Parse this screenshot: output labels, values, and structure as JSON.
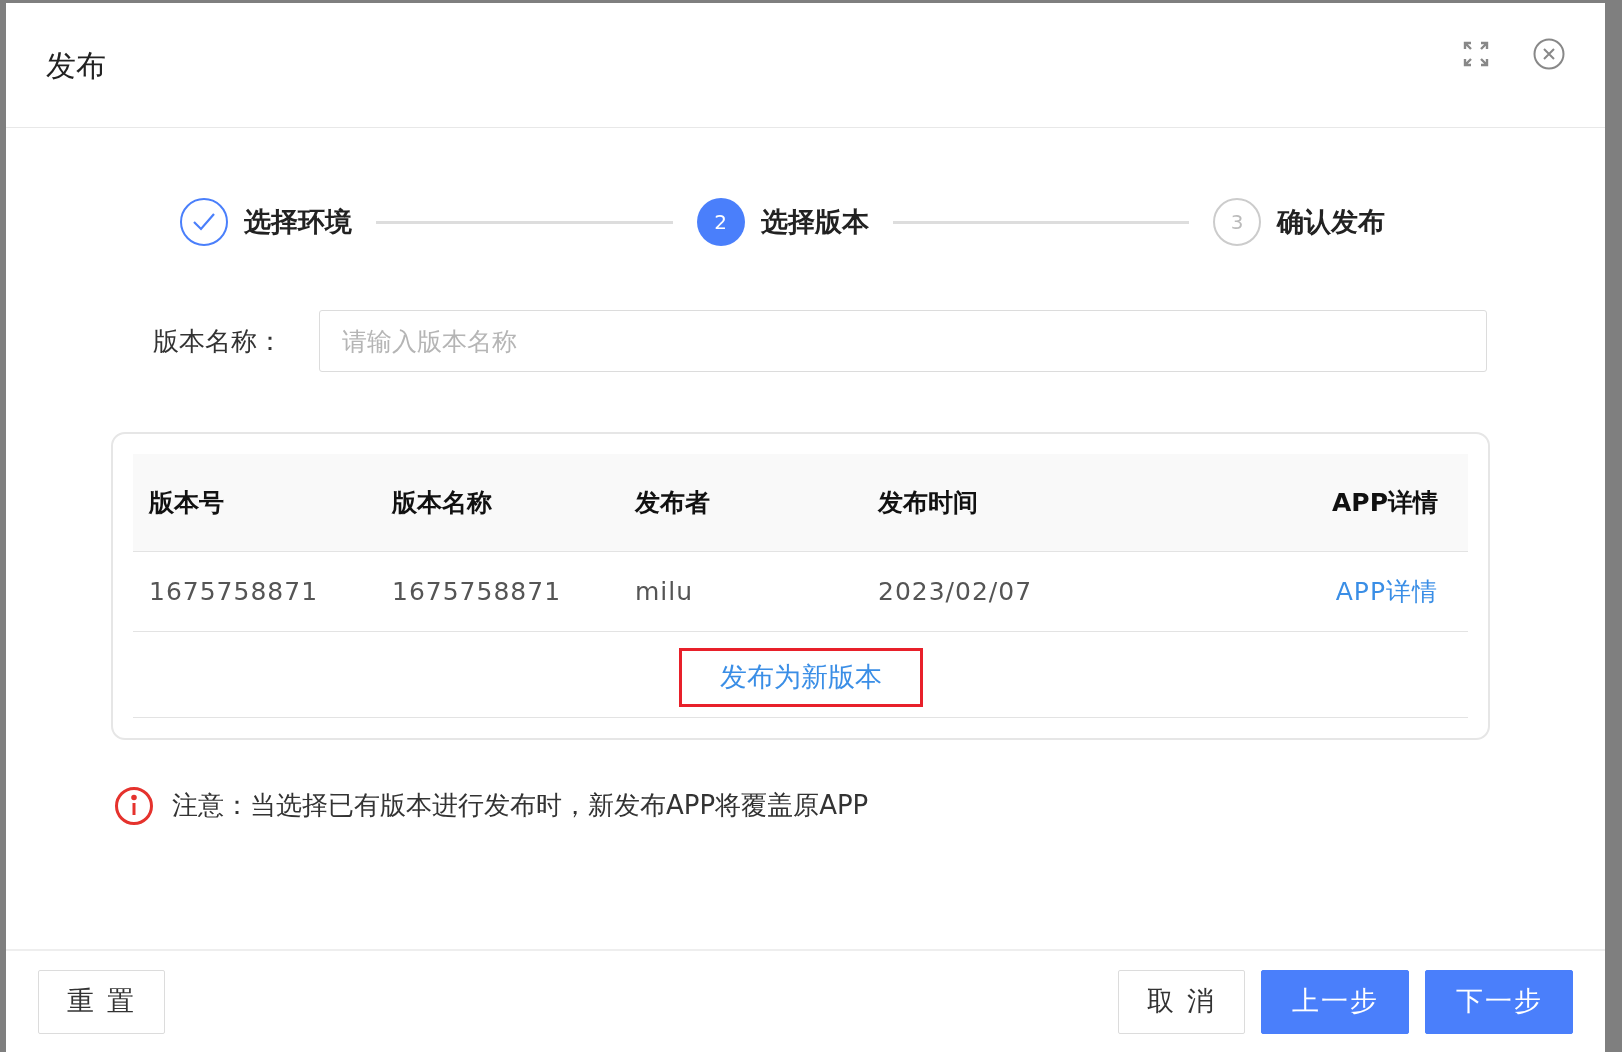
{
  "dialog": {
    "title": "发布"
  },
  "steps": [
    {
      "label": "选择环境",
      "completed": true,
      "selected": false
    },
    {
      "number": "2",
      "label": "选择版本",
      "completed": false,
      "selected": true
    },
    {
      "number": "3",
      "label": "确认发布",
      "completed": false,
      "selected": false
    }
  ],
  "version_name_field": {
    "label": "版本名称：",
    "placeholder": "请输入版本名称"
  },
  "table": {
    "columns": [
      "版本号",
      "版本名称",
      "发布者",
      "发布时间",
      "APP详情"
    ],
    "rows": [
      {
        "cells": [
          "1675758871",
          "1675758871",
          "milu",
          "2023/02/07"
        ],
        "link": "APP详情",
        "selected": false
      }
    ],
    "publish_new_button": {
      "label": "发布为新版本",
      "highlighted": true
    }
  },
  "notice": "注意：当选择已有版本进行发布时，新发布APP将覆盖原APP",
  "footer": {
    "left_buttons": [
      {
        "label": "重 置"
      }
    ],
    "right_buttons": [
      {
        "label": "取 消",
        "kind": "default"
      },
      {
        "label": "上一步",
        "kind": "primary"
      },
      {
        "label": "下一步",
        "kind": "primary"
      }
    ]
  }
}
